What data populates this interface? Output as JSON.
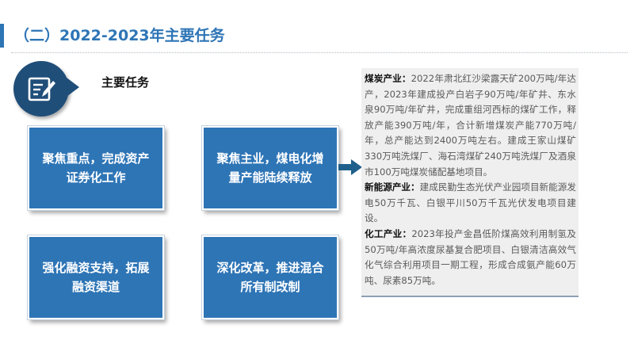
{
  "header": {
    "title": "（二）2022-2023年主要任务"
  },
  "section": {
    "label": "主要任务",
    "icon": "document-edit-icon"
  },
  "tasks": [
    {
      "label": "聚焦重点，完成资产证券化工作"
    },
    {
      "label": "聚焦主业，煤电化增量产能陆续释放"
    },
    {
      "label": "强化融资支持，拓展融资渠道"
    },
    {
      "label": "深化改革，推进混合所有制改制"
    }
  ],
  "details": [
    {
      "term": "煤炭产业：",
      "text": "2022年肃北红沙梁露天矿200万吨/年达产，2023年建成投产白岩子90万吨/年矿井、东水泉90万吨/年矿井，完成重组河西标的煤矿工作，释放产能390万吨/年，合计新增煤炭产能770万吨/年，总产能达到2400万吨左右。建成王家山煤矿330万吨洗煤厂、海石湾煤矿240万吨洗煤厂及酒泉市100万吨煤炭储配基地项目。"
    },
    {
      "term": "新能源产业：",
      "text": "建成民勤生态光伏产业园项目新能源发电50万千瓦、白银平川50万千瓦光伏发电项目建设。"
    },
    {
      "term": "化工产业：",
      "text": "2023年投产金昌低阶煤高效利用制氢及50万吨/年高浓度尿基复合肥项目、白银清洁高效气化气综合利用项目一期工程，形成合成氨产能60万吨、尿素85万吨。"
    }
  ],
  "colors": {
    "accent": "#2e75b6",
    "dark_accent": "#1f4e79",
    "panel_bg": "#efefef"
  }
}
